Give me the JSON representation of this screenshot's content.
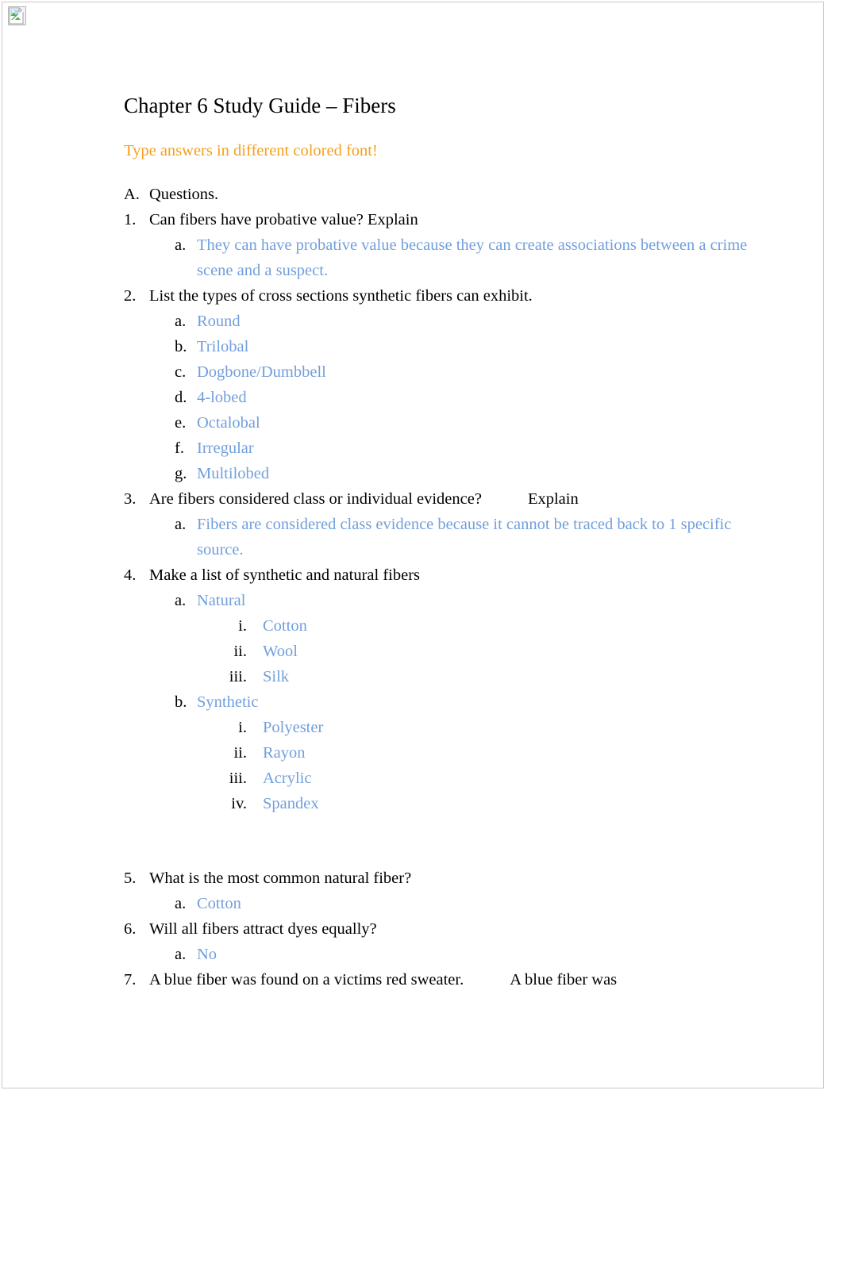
{
  "page": {
    "background_color": "#ffffff",
    "border_color": "#c9c9c9"
  },
  "placeholder_image": {
    "icon": "broken-image-icon",
    "alt": ""
  },
  "document": {
    "title": "Chapter 6 Study Guide – Fibers",
    "note": "Type answers in different colored font!",
    "colors": {
      "question_text": "#000000",
      "answer_text": "#729fdc",
      "note_text": "#f5a01e"
    },
    "section_a": {
      "marker": "A.",
      "label": "Questions."
    },
    "items": [
      {
        "marker": "1.",
        "question": "Can fibers have probative value? Explain",
        "answers": [
          {
            "marker": "a.",
            "text": "They can have probative value because they can create associations between a crime scene and a suspect."
          }
        ]
      },
      {
        "marker": "2.",
        "question": "List the types of cross sections synthetic fibers can exhibit.",
        "answers": [
          {
            "marker": "a.",
            "text": "Round"
          },
          {
            "marker": "b.",
            "text": "Trilobal"
          },
          {
            "marker": "c.",
            "text": "Dogbone/Dumbbell"
          },
          {
            "marker": "d.",
            "text": "4-lobed"
          },
          {
            "marker": "e.",
            "text": "Octalobal"
          },
          {
            "marker": "f.",
            "text": "Irregular"
          },
          {
            "marker": "g.",
            "text": "Multilobed"
          }
        ]
      },
      {
        "marker": "3.",
        "question_part1": "Are fibers considered class or individual evidence?",
        "question_part2": "Explain",
        "answers": [
          {
            "marker": "a.",
            "text": "Fibers are considered class evidence because it cannot be traced back to 1 specific source."
          }
        ]
      },
      {
        "marker": "4.",
        "question": "Make a list of synthetic and natural fibers",
        "answers": [
          {
            "marker": "a.",
            "text": "Natural",
            "sub": [
              {
                "marker": "i.",
                "text": "Cotton"
              },
              {
                "marker": "ii.",
                "text": "Wool"
              },
              {
                "marker": "iii.",
                "text": "Silk"
              }
            ]
          },
          {
            "marker": "b.",
            "text": "Synthetic",
            "sub": [
              {
                "marker": "i.",
                "text": "Polyester"
              },
              {
                "marker": "ii.",
                "text": "Rayon"
              },
              {
                "marker": "iii.",
                "text": "Acrylic"
              },
              {
                "marker": "iv.",
                "text": "Spandex"
              }
            ]
          }
        ]
      },
      {
        "marker": "5.",
        "question": "What is the most common natural fiber?",
        "answers": [
          {
            "marker": "a.",
            "text": "Cotton"
          }
        ]
      },
      {
        "marker": "6.",
        "question": "Will all fibers attract dyes equally?",
        "answers": [
          {
            "marker": "a.",
            "text": "No"
          }
        ]
      },
      {
        "marker": "7.",
        "question_part1": "A blue fiber was found on a victims red sweater.",
        "question_part2": "A blue fiber was",
        "answers": []
      }
    ]
  }
}
